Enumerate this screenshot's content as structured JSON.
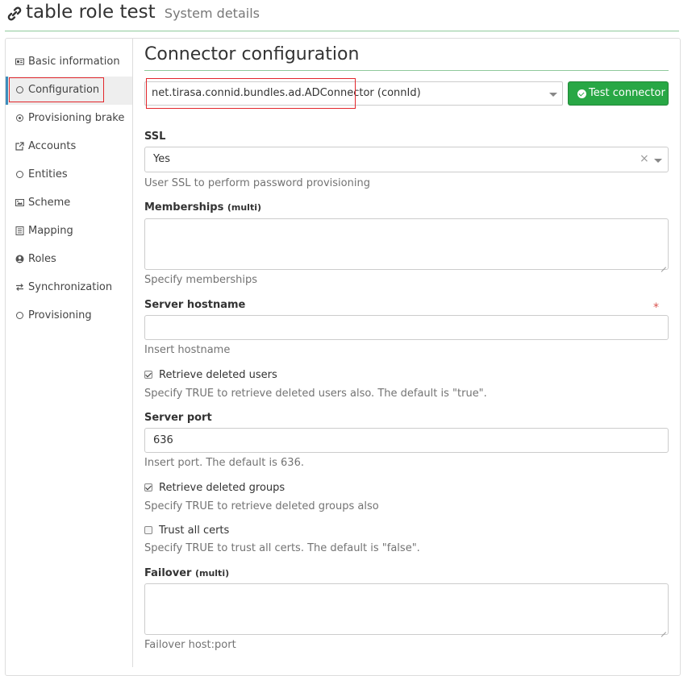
{
  "header": {
    "title": "table role test",
    "subtitle": "System details",
    "icon": "link-icon"
  },
  "sidebar": {
    "items": [
      {
        "label": "Basic information",
        "icon": "id-card-icon"
      },
      {
        "label": "Configuration",
        "icon": "circle-icon",
        "active": true
      },
      {
        "label": "Provisioning brake",
        "icon": "dot-circle-icon"
      },
      {
        "label": "Accounts",
        "icon": "external-link-icon"
      },
      {
        "label": "Entities",
        "icon": "circle-icon"
      },
      {
        "label": "Scheme",
        "icon": "image-icon"
      },
      {
        "label": "Mapping",
        "icon": "list-icon"
      },
      {
        "label": "Roles",
        "icon": "user-circle-icon"
      },
      {
        "label": "Synchronization",
        "icon": "exchange-icon"
      },
      {
        "label": "Provisioning",
        "icon": "circle-icon"
      }
    ]
  },
  "main": {
    "title": "Connector configuration",
    "connector": {
      "value": "net.tirasa.connid.bundles.ad.ADConnector (connId)"
    },
    "test_button": "Test connector",
    "ssl": {
      "label": "SSL",
      "value": "Yes",
      "help": "User SSL to perform password provisioning"
    },
    "memberships": {
      "label": "Memberships",
      "multi": "(multi)",
      "value": "",
      "help": "Specify memberships"
    },
    "server_hostname": {
      "label": "Server hostname",
      "required": "*",
      "value": "",
      "help": "Insert hostname"
    },
    "retrieve_deleted_users": {
      "label": "Retrieve deleted users",
      "checked": true,
      "help": "Specify TRUE to retrieve deleted users also. The default is \"true\"."
    },
    "server_port": {
      "label": "Server port",
      "value": "636",
      "help": "Insert port. The default is 636."
    },
    "retrieve_deleted_groups": {
      "label": "Retrieve deleted groups",
      "checked": true,
      "help": "Specify TRUE to retrieve deleted groups also"
    },
    "trust_all_certs": {
      "label": "Trust all certs",
      "checked": false,
      "help": "Specify TRUE to trust all certs. The default is \"false\"."
    },
    "failover": {
      "label": "Failover",
      "multi": "(multi)",
      "value": "",
      "help": "Failover host:port"
    }
  },
  "colors": {
    "accent_green": "#28a745",
    "header_rule": "#8fc99b",
    "highlight_box": "#e3262b",
    "required": "#d9534f"
  }
}
